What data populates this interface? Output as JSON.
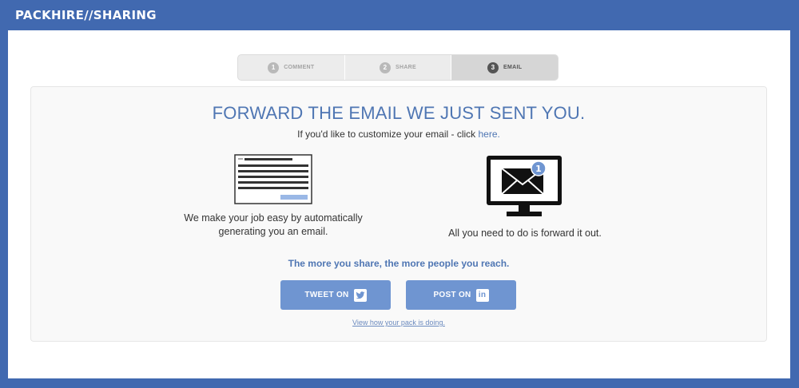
{
  "app": {
    "brand": "PACKHIRE//SHARING"
  },
  "steps": [
    {
      "num": "1",
      "label": "COMMENT",
      "active": false
    },
    {
      "num": "2",
      "label": "SHARE",
      "active": false
    },
    {
      "num": "3",
      "label": "EMAIL",
      "active": true
    }
  ],
  "main": {
    "heading": "FORWARD THE EMAIL WE JUST SENT YOU.",
    "sub_prefix": "If you'd like to customize your email - click ",
    "sub_link": "here.",
    "left_caption_line1": "We make your job easy by automatically",
    "left_caption_line2": "generating you an email.",
    "right_caption": "All you need to do is forward it out.",
    "email_badge": "1",
    "share_line": "The more you share, the more people you reach.",
    "tweet_label": "TWEET ON",
    "post_label": "POST ON",
    "view_link": "View how your pack is doing."
  },
  "colors": {
    "brand_blue": "#4169b0",
    "accent": "#4f76b3",
    "button": "#6f95d1"
  },
  "icons": {
    "twitter": "twitter-icon",
    "linkedin": "linkedin-icon",
    "email": "envelope-icon",
    "monitor": "monitor-icon"
  }
}
